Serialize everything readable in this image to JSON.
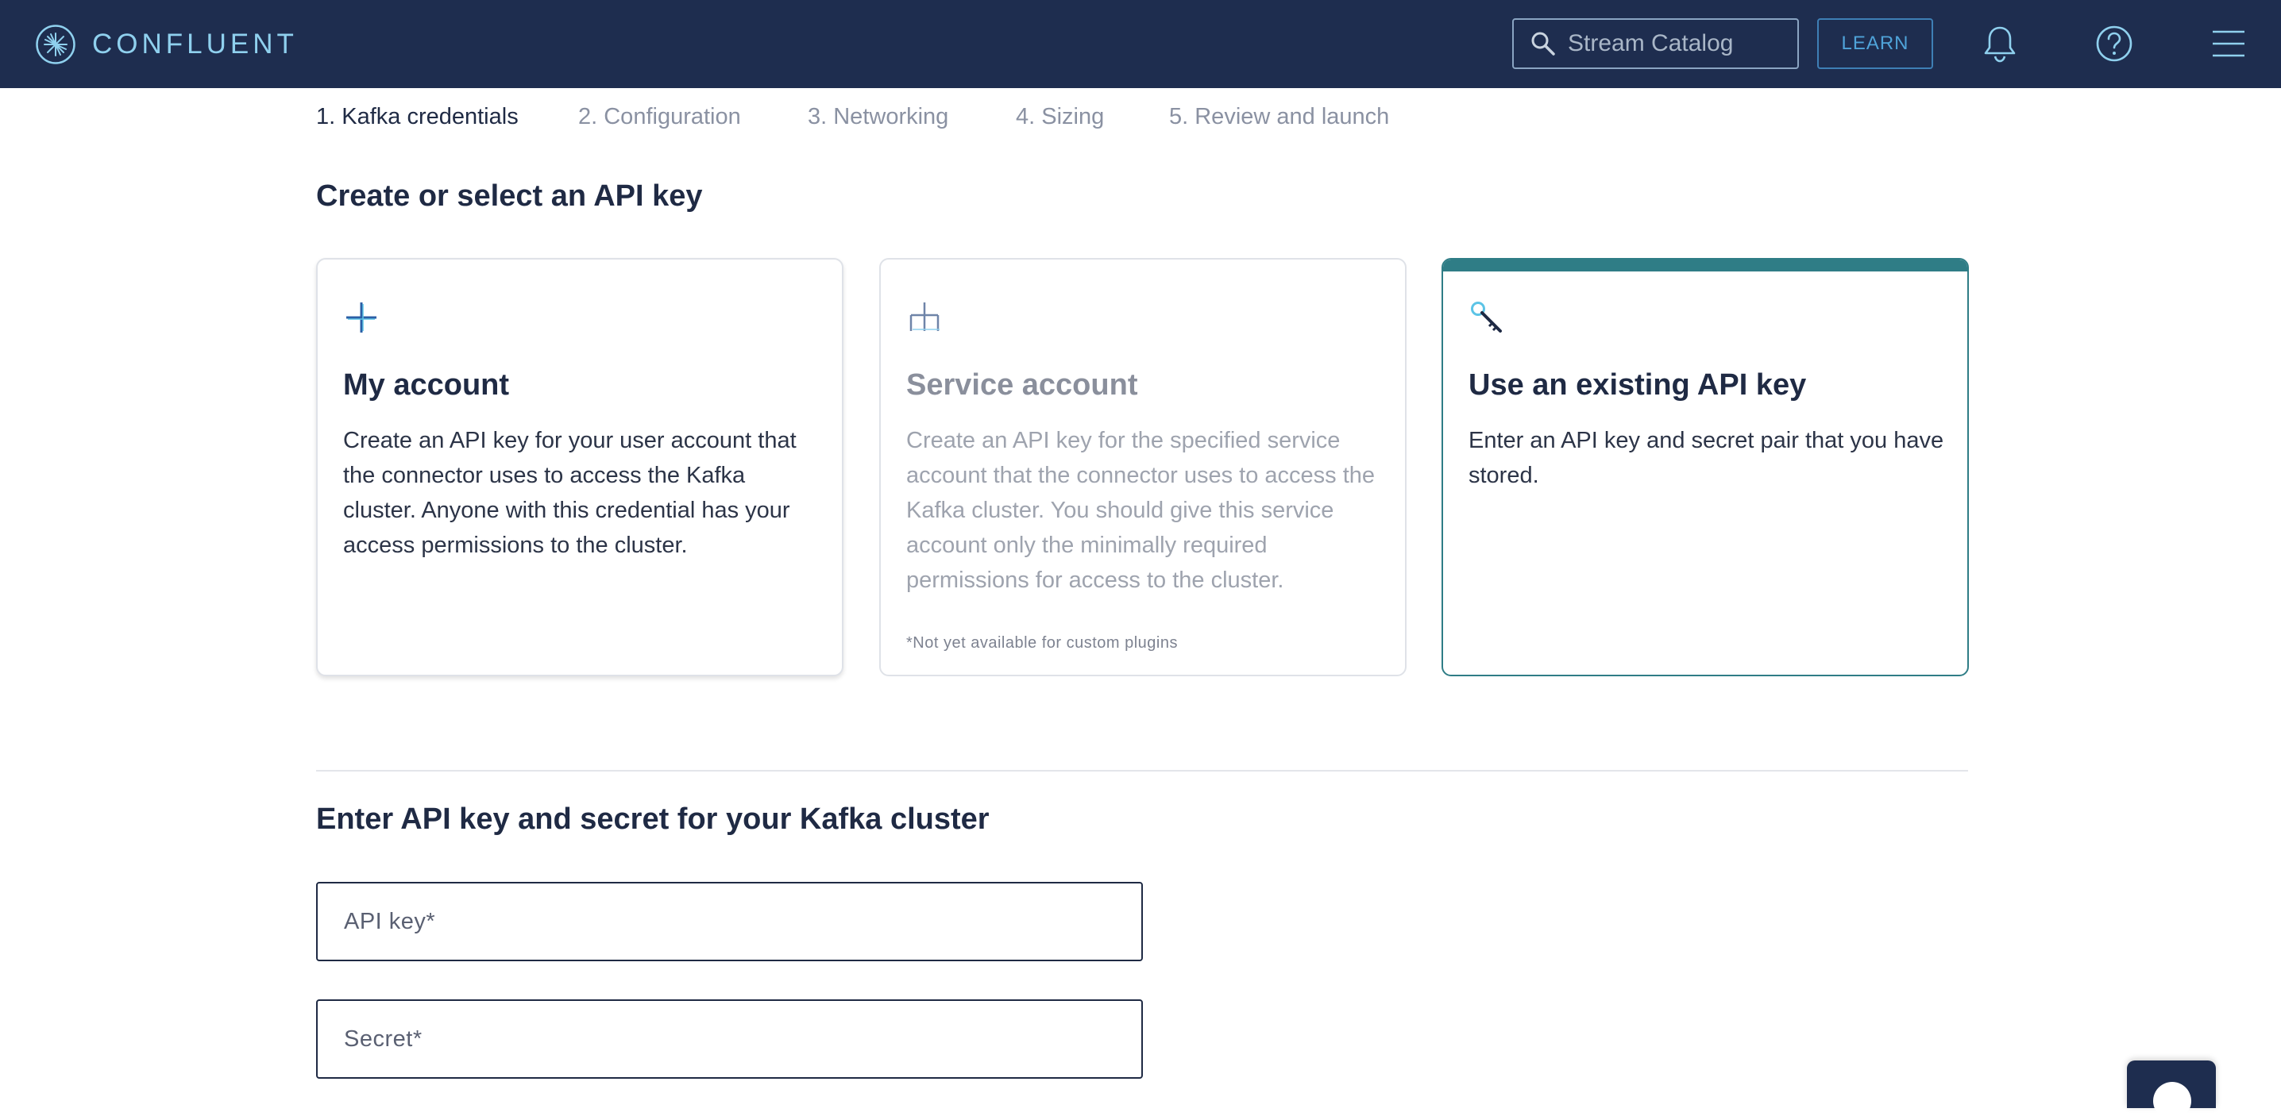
{
  "brand": {
    "name": "CONFLUENT",
    "logo_icon": "confluent-starburst-icon",
    "accent": "#8fd0ee"
  },
  "header": {
    "search_placeholder": "Stream Catalog",
    "learn_label": "LEARN",
    "icons": [
      "search-icon",
      "bell-icon",
      "help-icon",
      "menu-icon"
    ],
    "background": "#1e2d4f"
  },
  "steps": [
    {
      "label": "1. Kafka credentials",
      "active": true
    },
    {
      "label": "2. Configuration",
      "active": false
    },
    {
      "label": "3. Networking",
      "active": false
    },
    {
      "label": "4. Sizing",
      "active": false
    },
    {
      "label": "5. Review and launch",
      "active": false
    }
  ],
  "api_key_section": {
    "title": "Create or select an API key",
    "cards": [
      {
        "icon": "plus-icon",
        "title": "My account",
        "description": "Create an API key for your user account that the connector uses to access the Kafka cluster. Anyone with this credential has your access permissions to the cluster.",
        "selected": false,
        "disabled": false
      },
      {
        "icon": "org-chart-icon",
        "title": "Service account",
        "description": "Create an API key for the specified service account that the connector uses to access the Kafka cluster. You should give this service account only the minimally required permissions for access to the cluster.",
        "note": "*Not yet available for custom plugins",
        "selected": false,
        "disabled": true
      },
      {
        "icon": "key-icon",
        "title": "Use an existing API key",
        "description": "Enter an API key and secret pair that you have stored.",
        "selected": true,
        "disabled": false
      }
    ],
    "selected_color": "#2f7d86"
  },
  "credentials_section": {
    "title": "Enter API key and secret for your Kafka cluster",
    "api_key": {
      "placeholder": "API key*",
      "value": ""
    },
    "secret": {
      "placeholder": "Secret*",
      "value": ""
    }
  }
}
